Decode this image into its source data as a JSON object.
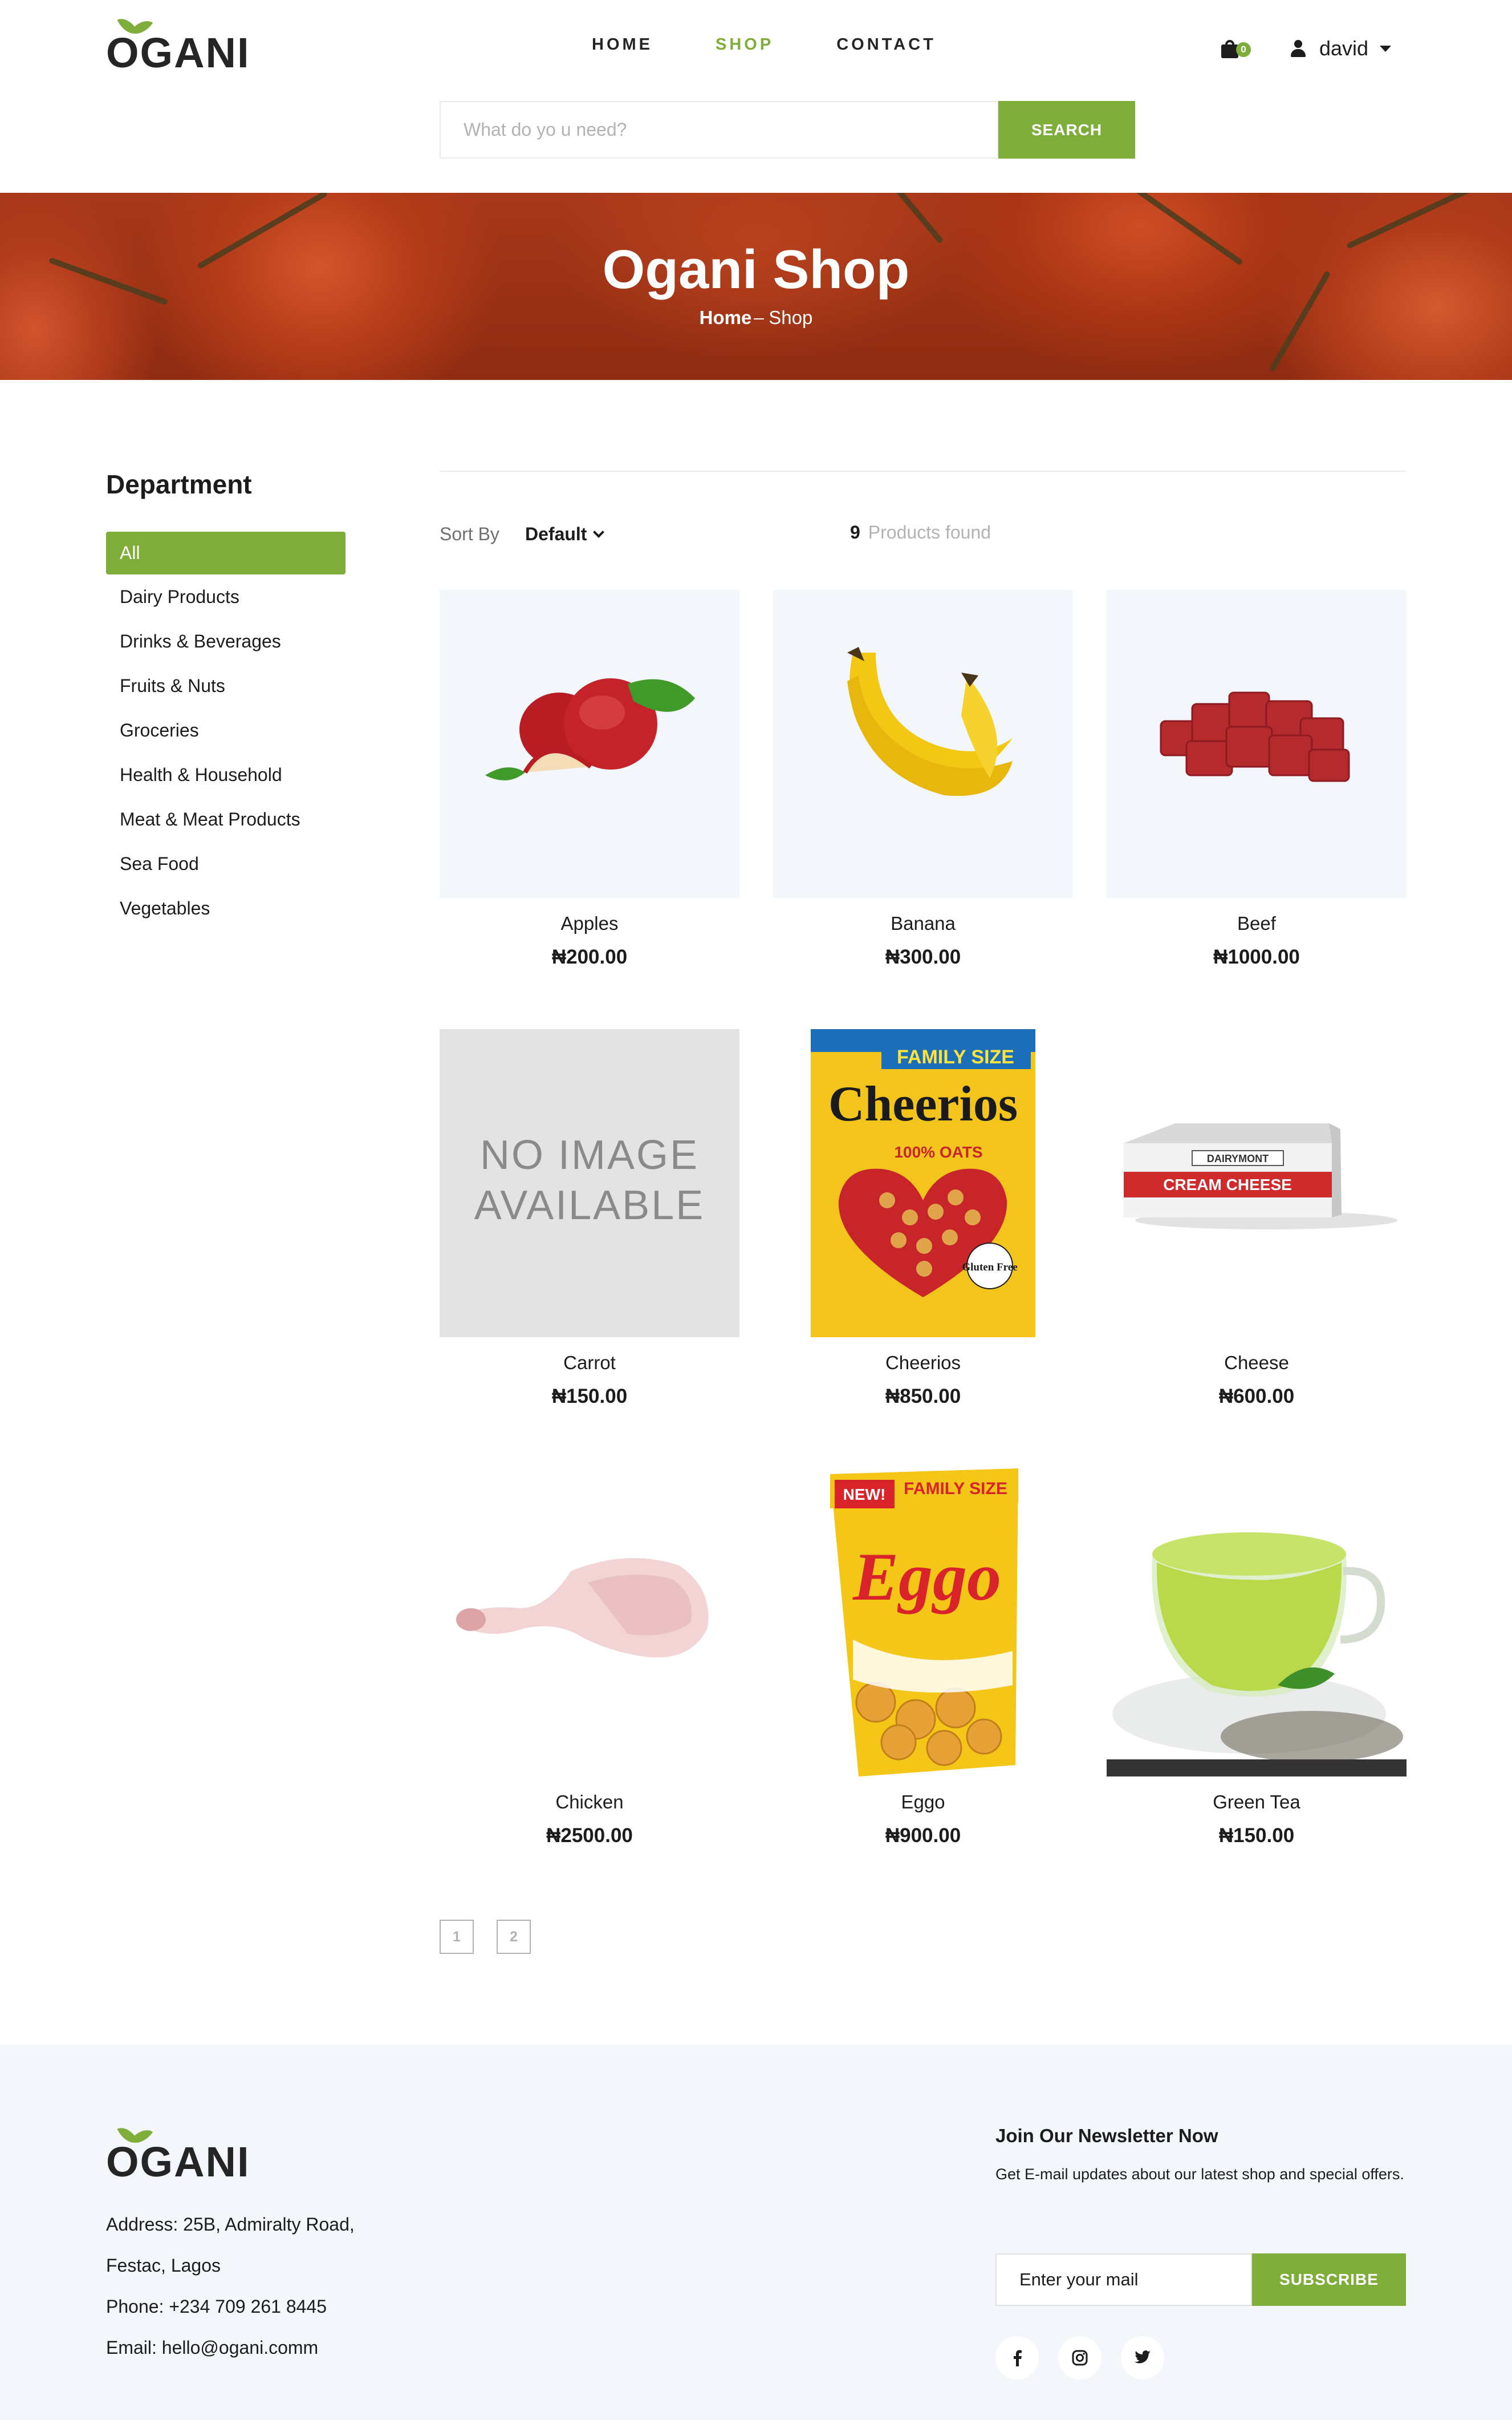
{
  "brand": {
    "name": "OGANI",
    "accent": "#7fad39"
  },
  "nav": {
    "items": [
      {
        "label": "HOME",
        "active": false
      },
      {
        "label": "SHOP",
        "active": true
      },
      {
        "label": "CONTACT",
        "active": false
      }
    ]
  },
  "cart": {
    "count": "0",
    "icon": "shopping-bag-icon"
  },
  "user": {
    "name": "david",
    "icon": "user-icon"
  },
  "search": {
    "placeholder": "What do yo u need?",
    "button": "SEARCH"
  },
  "hero": {
    "title": "Ogani Shop",
    "crumb_home": "Home",
    "crumb_current": "Shop"
  },
  "sidebar": {
    "title": "Department",
    "items": [
      {
        "label": "All",
        "active": true
      },
      {
        "label": "Dairy Products"
      },
      {
        "label": "Drinks & Beverages"
      },
      {
        "label": "Fruits & Nuts"
      },
      {
        "label": "Groceries"
      },
      {
        "label": "Health & Household"
      },
      {
        "label": "Meat & Meat Products"
      },
      {
        "label": "Sea Food"
      },
      {
        "label": "Vegetables"
      }
    ]
  },
  "toolbar": {
    "sort_label": "Sort By",
    "sort_value": "Default",
    "found_count": "9",
    "found_label": "Products found"
  },
  "products": [
    {
      "name": "Apples",
      "price": "₦200.00"
    },
    {
      "name": "Banana",
      "price": "₦300.00"
    },
    {
      "name": "Beef",
      "price": "₦1000.00"
    },
    {
      "name": "Carrot",
      "price": "₦150.00",
      "image_text": [
        "NO IMAGE",
        "AVAILABLE"
      ]
    },
    {
      "name": "Cheerios",
      "price": "₦850.00",
      "image_text": [
        "FAMILY SIZE",
        "Cheerios",
        "100% OATS",
        "Gluten Free"
      ]
    },
    {
      "name": "Cheese",
      "price": "₦600.00",
      "image_text": [
        "DAIRYMONT",
        "CREAM CHEESE"
      ]
    },
    {
      "name": "Chicken",
      "price": "₦2500.00"
    },
    {
      "name": "Eggo",
      "price": "₦900.00",
      "image_text": [
        "NEW!",
        "FAMILY SIZE",
        "Eggo"
      ]
    },
    {
      "name": "Green Tea",
      "price": "₦150.00"
    }
  ],
  "pagination": {
    "pages": [
      "1",
      "2"
    ]
  },
  "footer": {
    "address_line1": "Address: 25B, Admiralty Road,",
    "address_line2": "Festac, Lagos",
    "phone": "Phone: +234 709 261 8445",
    "email": "Email: hello@ogani.comm",
    "newsletter_title": "Join Our Newsletter Now",
    "newsletter_text": "Get E-mail updates about our latest shop and special offers.",
    "email_placeholder": "Enter your mail",
    "subscribe": "SUBSCRIBE",
    "social": [
      {
        "icon": "facebook-icon",
        "glyph": "f"
      },
      {
        "icon": "instagram-icon",
        "glyph": "◎"
      },
      {
        "icon": "twitter-icon",
        "glyph": "🐦"
      }
    ]
  }
}
